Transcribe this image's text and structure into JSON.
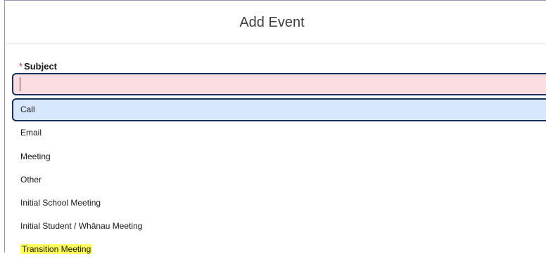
{
  "modal": {
    "title": "Add Event"
  },
  "subject_field": {
    "required_marker": "*",
    "label": "Subject",
    "value": ""
  },
  "subject_options": [
    {
      "label": "Call",
      "state": "focused"
    },
    {
      "label": "Email",
      "state": "default"
    },
    {
      "label": "Meeting",
      "state": "default"
    },
    {
      "label": "Other",
      "state": "default"
    },
    {
      "label": "Initial School Meeting",
      "state": "default"
    },
    {
      "label": "Initial Student / Whānau Meeting",
      "state": "default"
    },
    {
      "label": "Transition Meeting",
      "state": "highlighted"
    }
  ],
  "colors": {
    "required_star": "#c23934",
    "input_fill": "#fbdde2",
    "focus_border": "#16325c",
    "focused_option_fill": "#d8e6fe",
    "highlight": "#ffff5c"
  }
}
